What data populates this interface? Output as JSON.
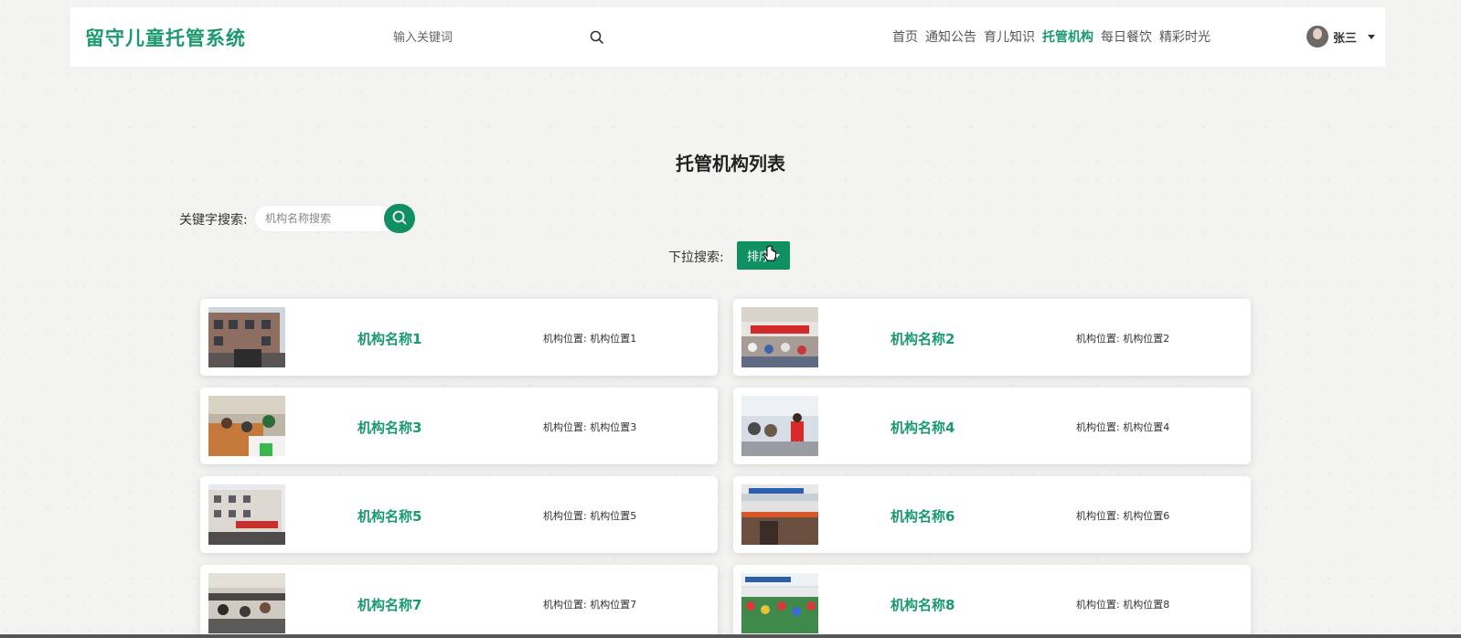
{
  "header": {
    "logo": "留守儿童托管系统",
    "search_placeholder": "输入关键词",
    "nav": [
      {
        "label": "首页",
        "active": false
      },
      {
        "label": "通知公告",
        "active": false
      },
      {
        "label": "育儿知识",
        "active": false
      },
      {
        "label": "托管机构",
        "active": true
      },
      {
        "label": "每日餐饮",
        "active": false
      },
      {
        "label": "精彩时光",
        "active": false
      }
    ],
    "user_name": "张三"
  },
  "page_title": "托管机构列表",
  "keyword_search": {
    "label": "关键字搜索:",
    "placeholder": "机构名称搜索"
  },
  "dropdown_search": {
    "label": "下拉搜索:",
    "button_label": "排序"
  },
  "cards": [
    {
      "name": "机构名称1",
      "location": "机构位置: 机构位置1"
    },
    {
      "name": "机构名称2",
      "location": "机构位置: 机构位置2"
    },
    {
      "name": "机构名称3",
      "location": "机构位置: 机构位置3"
    },
    {
      "name": "机构名称4",
      "location": "机构位置: 机构位置4"
    },
    {
      "name": "机构名称5",
      "location": "机构位置: 机构位置5"
    },
    {
      "name": "机构名称6",
      "location": "机构位置: 机构位置6"
    },
    {
      "name": "机构名称7",
      "location": "机构位置: 机构位置7"
    },
    {
      "name": "机构名称8",
      "location": "机构位置: 机构位置8"
    }
  ],
  "colors": {
    "accent": "#1a9a6c",
    "button": "#0f8f62"
  }
}
